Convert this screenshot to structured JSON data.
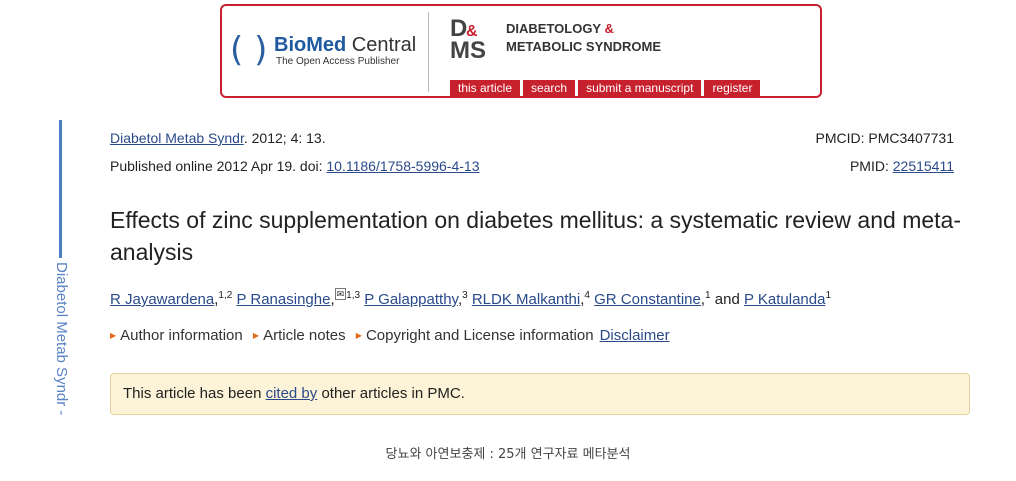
{
  "banner": {
    "publisher_bold": "BioMed",
    "publisher_light": " Central",
    "publisher_tagline": "The Open Access Publisher",
    "journal_logo": "D&MS",
    "journal_line1": "DIABETOLOGY",
    "journal_amp": " &",
    "journal_line2": "METABOLIC SYNDROME",
    "nav": [
      "this article",
      "search",
      "submit a manuscript",
      "register"
    ],
    "accent_color": "#c8212e"
  },
  "side_label": "Diabetol Metab Syndr -",
  "citation": {
    "journal": "Diabetol Metab Syndr",
    "volume": ". 2012; 4: 13.",
    "published": "Published online 2012 Apr 19. doi: ",
    "doi": "10.1186/1758-5996-4-13",
    "pmcid": "PMCID: PMC3407731",
    "pmid_label": "PMID: ",
    "pmid": "22515411"
  },
  "article": {
    "title": "Effects of zinc supplementation on diabetes mellitus: a systematic review and meta-analysis",
    "authors": [
      {
        "name": "R Jayawardena",
        "sup": "1,2"
      },
      {
        "name": "P Ranasinghe",
        "sup": "1,3"
      },
      {
        "name": "P Galappatthy",
        "sup": "3"
      },
      {
        "name": "RLDK Malkanthi",
        "sup": "4"
      },
      {
        "name": "GR Constantine",
        "sup": "1"
      },
      {
        "name": "P Katulanda",
        "sup": "1"
      }
    ],
    "and_text": "and"
  },
  "info_links": {
    "author_information": "Author information",
    "article_notes": "Article notes",
    "copyright": "Copyright and License information",
    "disclaimer": "Disclaimer"
  },
  "cited_box": {
    "prefix": "This article has been ",
    "link": "cited by",
    "suffix": " other articles in PMC."
  },
  "caption": "당뇨와 아연보충제 : 25개 연구자료 메타분석"
}
